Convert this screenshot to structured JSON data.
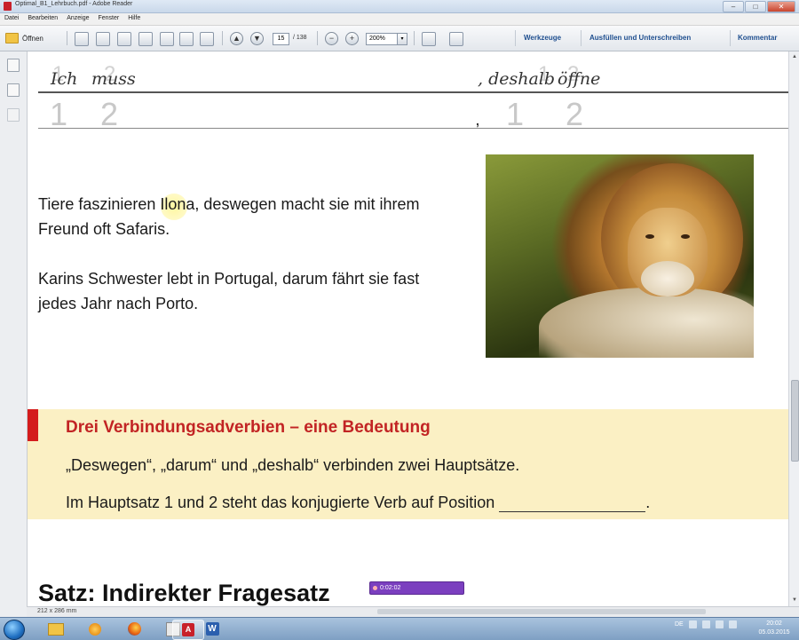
{
  "window": {
    "title": "Optimal_B1_Lehrbuch.pdf - Adobe Reader",
    "buttons": {
      "minimize": "–",
      "maximize": "□",
      "close": "✕"
    }
  },
  "menu": [
    "Datei",
    "Bearbeiten",
    "Anzeige",
    "Fenster",
    "Hilfe"
  ],
  "toolbar": {
    "open_label": "Öffnen",
    "page_current": "15",
    "page_total": "/ 138",
    "zoom_value": "200%",
    "zoom_drop": "▾",
    "zoom_out": "−",
    "zoom_in": "+",
    "prev_page": "▲",
    "next_page": "▼",
    "links": [
      "Werkzeuge",
      "Ausfüllen und Unterschreiben",
      "Kommentar"
    ]
  },
  "icons": {
    "open": "folder-icon",
    "save": "save-icon",
    "print": "print-icon",
    "mail": "mail-icon",
    "scroll_up": "▲",
    "scroll_down": "▼"
  },
  "handwriting": {
    "word1": "Ich",
    "word2": "muss",
    "word3": ", deshalb",
    "word4": "öffne",
    "ghost": [
      "1",
      "2",
      "1",
      "2"
    ],
    "small_ghost": [
      "1",
      "2",
      "1",
      "2"
    ],
    "comma": ","
  },
  "examples": {
    "para1": "Tiere faszinieren Ilona, deswegen macht sie mit ihrem Freund oft Safaris.",
    "para2": "Karins Schwester lebt in Portugal, darum fährt sie fast jedes Jahr nach Porto."
  },
  "infobox": {
    "heading": "Drei Verbindungsadverbien – eine Bedeutung",
    "line1": "„Deswegen“, „darum“ und „deshalb“ verbinden zwei Hauptsätze.",
    "line2": "Im Hauptsatz 1 und 2 steht das konjugierte Verb auf Position",
    "line2_end": "."
  },
  "bottom_heading": "Satz: Indirekter Fragesatz",
  "recorder": {
    "time": "0:02:02"
  },
  "status": {
    "page_size": "212 x 286 mm"
  },
  "taskbar": {
    "lang": "DE",
    "time": "20:02",
    "date": "05.03.2015"
  }
}
